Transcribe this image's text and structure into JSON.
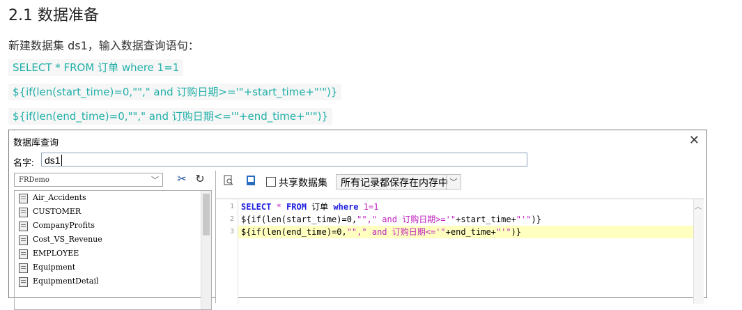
{
  "doc": {
    "heading": "2.1 数据准备",
    "intro": "新建数据集 ds1，输入数据查询语句：",
    "sql_lines": [
      "SELECT * FROM 订单 where 1=1",
      "${if(len(start_time)=0,\"\",\" and 订购日期>='\"+start_time+\"'\")}",
      "${if(len(end_time)=0,\"\",\" and 订购日期<='\"+end_time+\"'\")}"
    ]
  },
  "dialog": {
    "title": "数据库查询",
    "close_icon": "✕",
    "name_label": "名字:",
    "name_value": "ds1",
    "datasource": "FRDemo",
    "tables": [
      "Air_Accidents",
      "CUSTOMER",
      "CompanyProfits",
      "Cost_VS_Revenue",
      "EMPLOYEE",
      "Equipment",
      "EquipmentDetail"
    ],
    "share_label": "共享数据集",
    "memory_option": "所有记录都保存在内存中",
    "editor": {
      "line_numbers": [
        "1",
        "2",
        "3"
      ],
      "line1": {
        "kw1": "SELECT",
        "star": " * ",
        "kw2": "FROM",
        "table": " 订单 ",
        "kw3": "where",
        "rest": " 1=1"
      },
      "line2": {
        "a": "${if(len(start_time)=0,",
        "b": "\"\",\" and 订购日期>='\"",
        "c": "+start_time+",
        "d": "\"'\"",
        "e": ")}"
      },
      "line3": {
        "a": "${if(len(end_time)=0,",
        "b": "\"\",\" and 订购日期<='\"",
        "c": "+end_time+",
        "d": "\"'\"",
        "e": ")}"
      }
    }
  }
}
